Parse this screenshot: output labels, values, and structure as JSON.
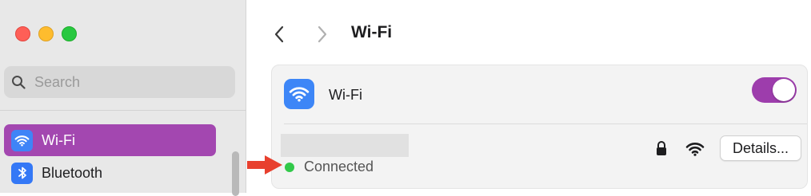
{
  "window": {
    "title": "Wi-Fi"
  },
  "sidebar": {
    "search": {
      "placeholder": "Search",
      "value": ""
    },
    "items": [
      {
        "label": "Wi-Fi",
        "icon": "wifi-icon",
        "active": true
      },
      {
        "label": "Bluetooth",
        "icon": "bluetooth-icon",
        "active": false
      }
    ]
  },
  "main": {
    "title": "Wi-Fi",
    "wifi_row": {
      "label": "Wi-Fi",
      "enabled": true
    },
    "network": {
      "status": "Connected",
      "details_label": "Details..."
    }
  },
  "colors": {
    "accent": "#a347b0",
    "toggle_on": "#9d3dac",
    "wifi_blue": "#3d86f7",
    "connected_green": "#32c94a",
    "annotation_arrow": "#e8402e"
  }
}
